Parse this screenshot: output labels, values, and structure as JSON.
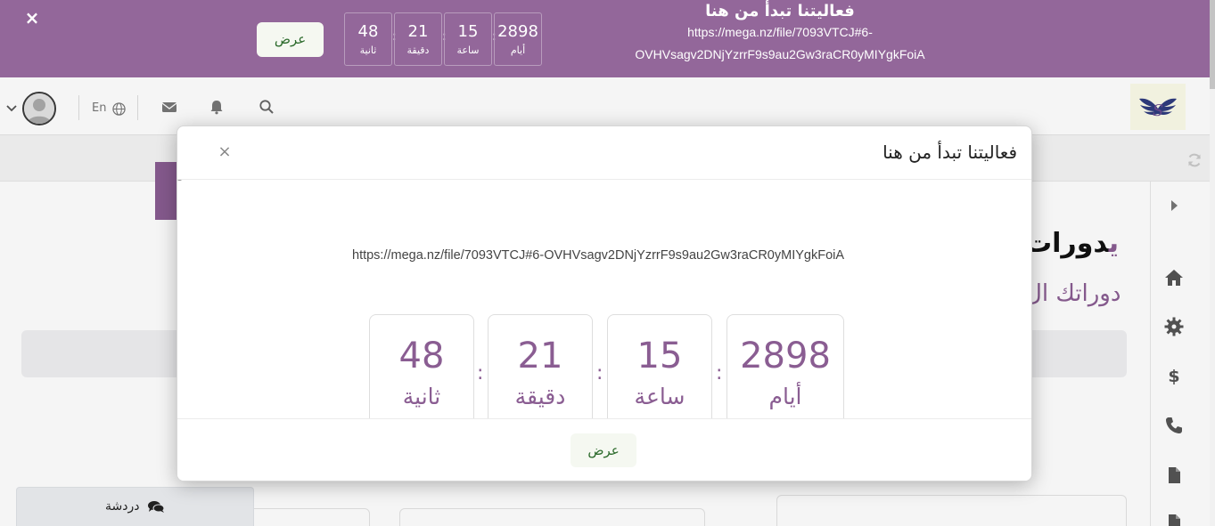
{
  "banner": {
    "title": "فعاليتنا تبدأ من هنا",
    "link_line1": "https://mega.nz/file/7093VTCJ#6-",
    "link_line2": "OVHVsagv2DNjYzrrF9s9au2Gw3raCR0yMIYgkFoiA",
    "view_button": "عرض",
    "close": "×",
    "countdown": {
      "days": {
        "value": "2898",
        "label": "أيام"
      },
      "hours": {
        "value": "15",
        "label": "ساعة"
      },
      "minutes": {
        "value": "21",
        "label": "دقيقة"
      },
      "seconds": {
        "value": "48",
        "label": "ثانية"
      },
      "separator": ":"
    }
  },
  "header": {
    "language": "En",
    "icons": [
      "search-icon",
      "bell-icon",
      "envelope-icon",
      "globe-icon",
      "user-avatar",
      "chevron-down-icon"
    ],
    "logo": "wings-logo"
  },
  "page": {
    "title_main": "دورات",
    "title_accent": "ي",
    "subtitle": "دوراتك ال",
    "side_rail_icons": [
      "caret-right-icon",
      "home-icon",
      "gear-icon",
      "dollar-icon",
      "phone-icon",
      "file-icon",
      "file-icon"
    ],
    "refresh_icon": "refresh-icon"
  },
  "modal": {
    "title": "فعاليتنا تبدأ من هنا",
    "close": "×",
    "link": "https://mega.nz/file/7093VTCJ#6-OVHVsagv2DNjYzrrF9s9au2Gw3raCR0yMIYgkFoiA",
    "countdown": {
      "days": {
        "value": "2898",
        "label": "أيام"
      },
      "hours": {
        "value": "15",
        "label": "ساعة"
      },
      "minutes": {
        "value": "21",
        "label": "دقيقة"
      },
      "seconds": {
        "value": "48",
        "label": "ثانية"
      },
      "separator": ":"
    },
    "view_button": "عرض"
  },
  "chat": {
    "label": "دردشة"
  },
  "colors": {
    "brand_purple": "#93679a",
    "accent_purple": "#8a5d92",
    "button_bg": "#f5f8f1",
    "button_text": "#2b6a2b"
  }
}
